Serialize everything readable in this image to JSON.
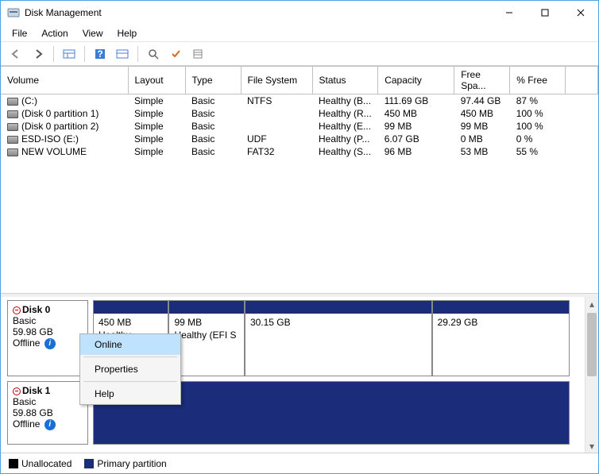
{
  "window": {
    "title": "Disk Management"
  },
  "menu": {
    "items": [
      "File",
      "Action",
      "View",
      "Help"
    ]
  },
  "columns": [
    "Volume",
    "Layout",
    "Type",
    "File System",
    "Status",
    "Capacity",
    "Free Spa...",
    "% Free"
  ],
  "volumes": [
    {
      "name": "(C:)",
      "layout": "Simple",
      "type": "Basic",
      "fs": "NTFS",
      "status": "Healthy (B...",
      "capacity": "111.69 GB",
      "free": "97.44 GB",
      "pct": "87 %"
    },
    {
      "name": "(Disk 0 partition 1)",
      "layout": "Simple",
      "type": "Basic",
      "fs": "",
      "status": "Healthy (R...",
      "capacity": "450 MB",
      "free": "450 MB",
      "pct": "100 %"
    },
    {
      "name": "(Disk 0 partition 2)",
      "layout": "Simple",
      "type": "Basic",
      "fs": "",
      "status": "Healthy (E...",
      "capacity": "99 MB",
      "free": "99 MB",
      "pct": "100 %"
    },
    {
      "name": "ESD-ISO (E:)",
      "layout": "Simple",
      "type": "Basic",
      "fs": "UDF",
      "status": "Healthy (P...",
      "capacity": "6.07 GB",
      "free": "0 MB",
      "pct": "0 %"
    },
    {
      "name": "NEW VOLUME",
      "layout": "Simple",
      "type": "Basic",
      "fs": "FAT32",
      "status": "Healthy (S...",
      "capacity": "96 MB",
      "free": "53 MB",
      "pct": "55 %"
    }
  ],
  "disks": [
    {
      "name": "Disk 0",
      "type": "Basic",
      "size": "59.98 GB",
      "state": "Offline",
      "parts": [
        {
          "size": "450 MB",
          "status": "Healthy (Recovery",
          "flex": 12,
          "head": true
        },
        {
          "size": "99 MB",
          "status": "Healthy (EFI S",
          "flex": 12,
          "head": true
        },
        {
          "size": "30.15 GB",
          "status": "",
          "flex": 30,
          "head": true
        },
        {
          "size": "29.29 GB",
          "status": "",
          "flex": 22,
          "head": true
        }
      ]
    },
    {
      "name": "Disk 1",
      "type": "Basic",
      "size": "59.88 GB",
      "state": "Offline",
      "parts": [
        {
          "size": "",
          "status": "",
          "flex": 1,
          "headFull": true
        }
      ]
    }
  ],
  "context_menu": {
    "items": [
      "Online",
      "Properties",
      "Help"
    ],
    "highlight_index": 0
  },
  "legend": {
    "unallocated": "Unallocated",
    "primary": "Primary partition"
  }
}
